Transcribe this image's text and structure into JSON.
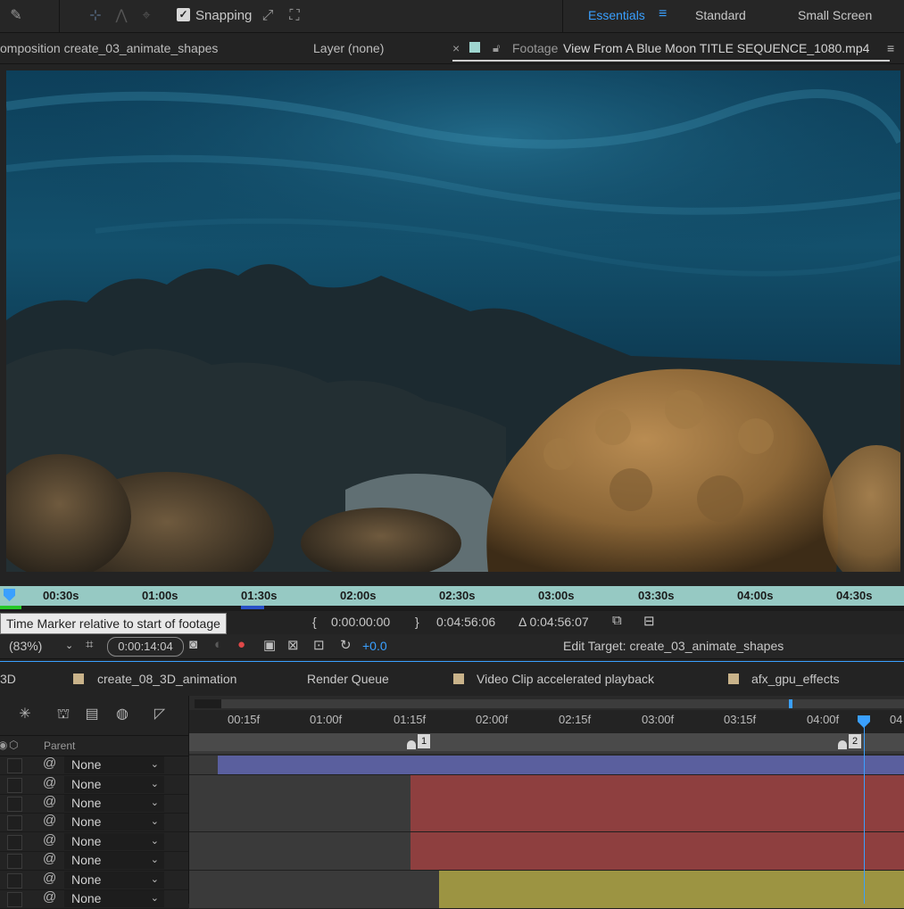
{
  "toolbar": {
    "snapping_label": "Snapping",
    "snapping_checked": true,
    "workspaces": [
      "Essentials",
      "Standard",
      "Small Screen"
    ],
    "active_workspace": "Essentials"
  },
  "panel_tabs": {
    "composition": "omposition create_03_animate_shapes",
    "layer": "Layer (none)",
    "footage_close": "×",
    "footage_prefix": "Footage",
    "footage_name": "View From A Blue Moon TITLE SEQUENCE_1080.mp4",
    "menu_icon": "≡"
  },
  "footage_ruler": {
    "ticks": [
      "00:30s",
      "01:00s",
      "01:30s",
      "02:00s",
      "02:30s",
      "03:00s",
      "03:30s",
      "04:00s",
      "04:30s"
    ]
  },
  "footage_info": {
    "tooltip": "Time Marker relative to start of footage",
    "in_point": "0:00:00:00",
    "out_point": "0:04:56:06",
    "duration": "Δ 0:04:56:07",
    "in_bracket": "{",
    "out_bracket": "}"
  },
  "viewer_controls": {
    "zoom": "(83%)",
    "current_time": "0:00:14:04",
    "offset": "+0.0",
    "edit_target": "Edit Target: create_03_animate_shapes"
  },
  "timeline_tabs": [
    {
      "label": "3D",
      "swatch": false
    },
    {
      "label": "create_08_3D_animation",
      "swatch": true
    },
    {
      "label": "Render Queue",
      "swatch": false
    },
    {
      "label": "Video Clip accelerated playback",
      "swatch": true
    },
    {
      "label": "afx_gpu_effects",
      "swatch": true
    }
  ],
  "layer_header": {
    "parent": "Parent"
  },
  "layers": [
    {
      "parent": "None"
    },
    {
      "parent": "None"
    },
    {
      "parent": "None"
    },
    {
      "parent": "None"
    },
    {
      "parent": "None"
    },
    {
      "parent": "None"
    },
    {
      "parent": "None"
    },
    {
      "parent": "None"
    }
  ],
  "timeline_ruler": {
    "ticks": [
      "00:15f",
      "01:00f",
      "01:15f",
      "02:00f",
      "02:15f",
      "03:00f",
      "03:15f",
      "04:00f",
      "04"
    ]
  },
  "markers": [
    "1",
    "2"
  ],
  "colors": {
    "accent": "#3aa0ff",
    "ruler": "#96c9c3",
    "bar_blue": "#5a5f9e",
    "bar_red": "#8e3f3f",
    "bar_yellow": "#9c9442"
  }
}
